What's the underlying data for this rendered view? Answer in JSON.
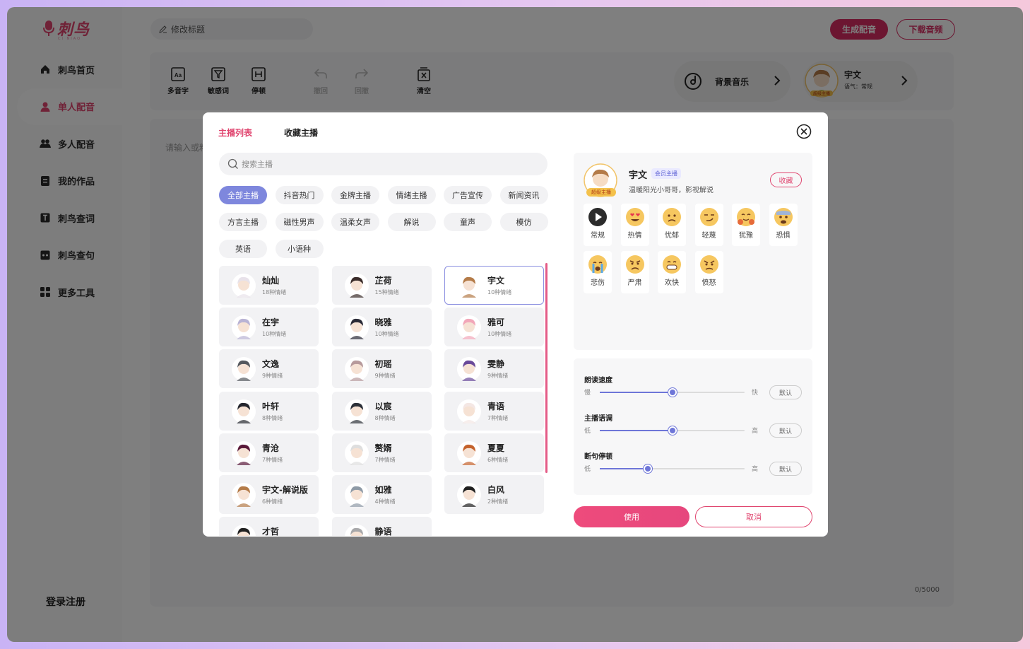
{
  "app": {
    "logo_text": "刺鸟",
    "logo_sub": "CI NIAO",
    "title_placeholder": "修改标题",
    "generate_label": "生成配音",
    "download_label": "下载音频",
    "login_label": "登录注册"
  },
  "sidebar": {
    "items": [
      {
        "label": "刺鸟首页",
        "icon": "home-icon"
      },
      {
        "label": "单人配音",
        "icon": "person-icon",
        "active": true
      },
      {
        "label": "多人配音",
        "icon": "group-icon"
      },
      {
        "label": "我的作品",
        "icon": "works-icon"
      },
      {
        "label": "刺鸟查词",
        "icon": "dictionary-icon"
      },
      {
        "label": "刺鸟查句",
        "icon": "quote-icon"
      },
      {
        "label": "更多工具",
        "icon": "grid-icon"
      }
    ]
  },
  "toolbar": {
    "tools": [
      {
        "label": "多音字",
        "icon": "polyphone-icon"
      },
      {
        "label": "敏感词",
        "icon": "filter-icon"
      },
      {
        "label": "停顿",
        "icon": "pause-icon"
      },
      {
        "label": "撤回",
        "icon": "undo-icon",
        "disabled": true
      },
      {
        "label": "回撤",
        "icon": "redo-icon",
        "disabled": true
      },
      {
        "label": "清空",
        "icon": "clear-icon"
      }
    ],
    "bgm_label": "背景音乐",
    "voice_name": "宇文",
    "voice_mood": "语气：常规",
    "voice_badge": "超级主播"
  },
  "editor": {
    "placeholder": "请输入或粘",
    "counter": "0/5000"
  },
  "modal": {
    "tabs": [
      "主播列表",
      "收藏主播"
    ],
    "search_placeholder": "搜索主播",
    "categories": [
      "全部主播",
      "抖音热门",
      "金牌主播",
      "情绪主播",
      "广告宣传",
      "新闻资讯",
      "方言主播",
      "磁性男声",
      "温柔女声",
      "解说",
      "童声",
      "模仿",
      "英语",
      "小语种"
    ],
    "voices": [
      {
        "name": "灿灿",
        "emotions": "18种情绪",
        "color": "#e8e2ea"
      },
      {
        "name": "芷荷",
        "emotions": "15种情绪",
        "color": "#3a2c2a"
      },
      {
        "name": "宇文",
        "emotions": "10种情绪",
        "color": "#b47b48",
        "selected": true
      },
      {
        "name": "在宇",
        "emotions": "10种情绪",
        "color": "#b9b3d4"
      },
      {
        "name": "晓雅",
        "emotions": "10种情绪",
        "color": "#2a2a36"
      },
      {
        "name": "雅可",
        "emotions": "10种情绪",
        "color": "#f2a7b9"
      },
      {
        "name": "文逸",
        "emotions": "9种情绪",
        "color": "#54585e"
      },
      {
        "name": "初瑶",
        "emotions": "9种情绪",
        "color": "#b79a9c"
      },
      {
        "name": "雯静",
        "emotions": "9种情绪",
        "color": "#6a4a9a"
      },
      {
        "name": "叶轩",
        "emotions": "8种情绪",
        "color": "#24262e"
      },
      {
        "name": "以宸",
        "emotions": "8种情绪",
        "color": "#2c3038"
      },
      {
        "name": "青语",
        "emotions": "7种情绪",
        "color": "#f4e7e4"
      },
      {
        "name": "青沧",
        "emotions": "7种情绪",
        "color": "#5a1a3a"
      },
      {
        "name": "赘婿",
        "emotions": "7种情绪",
        "color": "#dedede"
      },
      {
        "name": "夏夏",
        "emotions": "6种情绪",
        "color": "#c4622c"
      },
      {
        "name": "宇文-解说版",
        "emotions": "6种情绪",
        "color": "#b47b48"
      },
      {
        "name": "如雅",
        "emotions": "4种情绪",
        "color": "#8e9aa6"
      },
      {
        "name": "白风",
        "emotions": "2种情绪",
        "color": "#202020"
      },
      {
        "name": "才哲",
        "emotions": "",
        "color": "#202020"
      },
      {
        "name": "静语",
        "emotions": "",
        "color": "#a8a8aa"
      }
    ],
    "detail": {
      "name": "宇文",
      "vip_label": "会员主播",
      "badge": "超级主播",
      "description": "温暖阳光小哥哥，影视解说",
      "favorite_label": "收藏",
      "emotions": [
        {
          "label": "常规",
          "icon": "play-icon"
        },
        {
          "label": "热情",
          "icon": "heart-eyes-face-icon"
        },
        {
          "label": "忧郁",
          "icon": "worried-face-icon"
        },
        {
          "label": "轻蔑",
          "icon": "smirk-face-icon"
        },
        {
          "label": "犹豫",
          "icon": "hug-face-icon"
        },
        {
          "label": "恐惧",
          "icon": "fearful-face-icon"
        },
        {
          "label": "悲伤",
          "icon": "crying-face-icon"
        },
        {
          "label": "严肃",
          "icon": "pouting-face-icon"
        },
        {
          "label": "欢快",
          "icon": "grinning-face-icon"
        },
        {
          "label": "愤怒",
          "icon": "angry-face-icon"
        }
      ]
    },
    "params": [
      {
        "label": "朗读速度",
        "low": "慢",
        "high": "快",
        "value": 0.5,
        "reset": "默认"
      },
      {
        "label": "主播语调",
        "low": "低",
        "high": "高",
        "value": 0.5,
        "reset": "默认"
      },
      {
        "label": "断句停顿",
        "low": "低",
        "high": "高",
        "value": 0.33,
        "reset": "默认"
      }
    ],
    "use_label": "使用",
    "cancel_label": "取消"
  },
  "colors": {
    "accent": "#e0456f",
    "selected_chip": "#7e87dd",
    "slider": "#6e76d8"
  }
}
